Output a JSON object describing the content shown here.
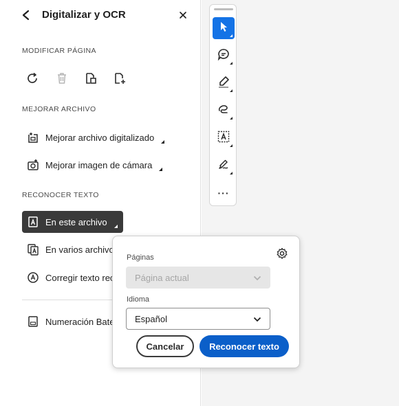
{
  "panel": {
    "title": "Digitalizar y OCR",
    "sections": {
      "modify": "MODIFICAR PÁGINA",
      "improve": "MEJORAR ARCHIVO",
      "recognize": "RECONOCER TEXTO"
    },
    "modify_tools": [
      {
        "icon": "rotate-icon"
      },
      {
        "icon": "delete-icon"
      },
      {
        "icon": "extract-page-icon"
      },
      {
        "icon": "insert-page-icon"
      }
    ],
    "improve_items": [
      {
        "label": "Mejorar archivo digitalizado",
        "icon": "enhance-scan-icon"
      },
      {
        "label": "Mejorar imagen de cámara",
        "icon": "enhance-camera-icon"
      }
    ],
    "recognize_items": [
      {
        "label": "En este archivo",
        "icon": "ocr-file-icon"
      },
      {
        "label": "En varios archivos",
        "icon": "ocr-multiple-files-icon"
      },
      {
        "label": "Corregir texto rec",
        "icon": "correct-text-icon"
      }
    ],
    "bates_label": "Numeración Bate"
  },
  "toolbar": {
    "tools": [
      "select-icon",
      "comment-icon",
      "highlight-icon",
      "draw-icon",
      "text-select-icon",
      "sign-icon",
      "more-icon"
    ],
    "more_glyph": "···"
  },
  "popover": {
    "pages_label": "Páginas",
    "pages_value": "Página actual",
    "language_label": "Idioma",
    "language_value": "Español",
    "cancel_label": "Cancelar",
    "confirm_label": "Reconocer texto"
  },
  "colors": {
    "accent": "#1473e6",
    "primary_button": "#0b5fc9",
    "active_item": "#3a3a3a"
  }
}
